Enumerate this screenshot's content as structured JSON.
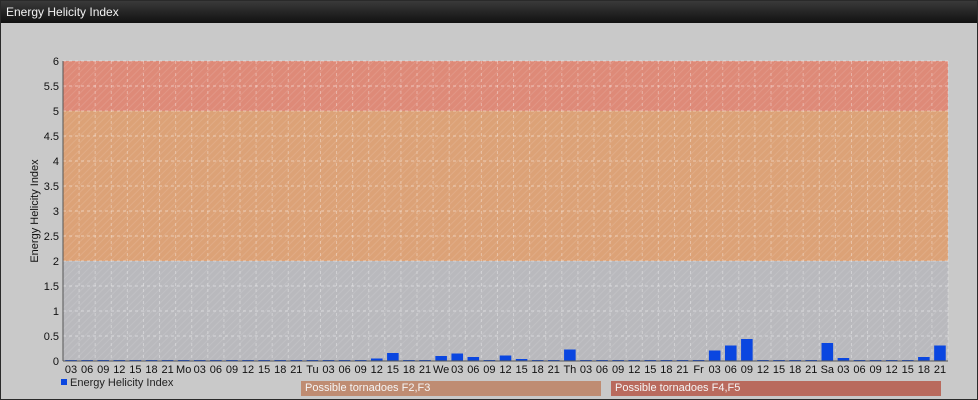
{
  "window": {
    "title": "Energy Helicity Index"
  },
  "chart_data": {
    "type": "bar",
    "title": "Energy Helicity Index",
    "ylabel": "Energy Helicity Index",
    "xlabel": "",
    "ylim": [
      0,
      6
    ],
    "yticks": [
      "0",
      "0.5",
      "1",
      "1.5",
      "2",
      "2.5",
      "3",
      "3.5",
      "4",
      "4.5",
      "5",
      "5.5",
      "6"
    ],
    "grid": true,
    "bands": [
      {
        "from": 0,
        "to": 2,
        "color": "#b9b9bd"
      },
      {
        "from": 2,
        "to": 5,
        "color": "#dca277"
      },
      {
        "from": 5,
        "to": 6,
        "color": "#de8a78"
      }
    ],
    "categories": [
      "03",
      "06",
      "09",
      "12",
      "15",
      "18",
      "21",
      "Mo",
      "03",
      "06",
      "09",
      "12",
      "15",
      "18",
      "21",
      "Tu",
      "03",
      "06",
      "09",
      "12",
      "15",
      "18",
      "21",
      "We",
      "03",
      "06",
      "09",
      "12",
      "15",
      "18",
      "21",
      "Th",
      "03",
      "06",
      "09",
      "12",
      "15",
      "18",
      "21",
      "Fr",
      "03",
      "06",
      "09",
      "12",
      "15",
      "18",
      "21",
      "Sa",
      "03",
      "06",
      "09",
      "12",
      "15",
      "18",
      "21"
    ],
    "series": [
      {
        "name": "Energy Helicity Index",
        "color": "#0a46e0",
        "values": [
          0.02,
          0.02,
          0.02,
          0.02,
          0.02,
          0.02,
          0.02,
          0.02,
          0.02,
          0.02,
          0.02,
          0.02,
          0.02,
          0.02,
          0.02,
          0.02,
          0.02,
          0.02,
          0.02,
          0.05,
          0.16,
          0.02,
          0.02,
          0.1,
          0.15,
          0.08,
          0.02,
          0.11,
          0.04,
          0.02,
          0.02,
          0.23,
          0.02,
          0.02,
          0.02,
          0.02,
          0.02,
          0.02,
          0.02,
          0.02,
          0.21,
          0.31,
          0.44,
          0.02,
          0.02,
          0.02,
          0.02,
          0.36,
          0.06,
          0.02,
          0.02,
          0.02,
          0.02,
          0.08,
          0.31
        ]
      }
    ],
    "legend_position": "bottom-left",
    "annotations": [
      {
        "label": "Possible tornadoes F2,F3",
        "color": "#bf8c72"
      },
      {
        "label": "Possible tornadoes F4,F5",
        "color": "#b96a5d"
      }
    ]
  }
}
